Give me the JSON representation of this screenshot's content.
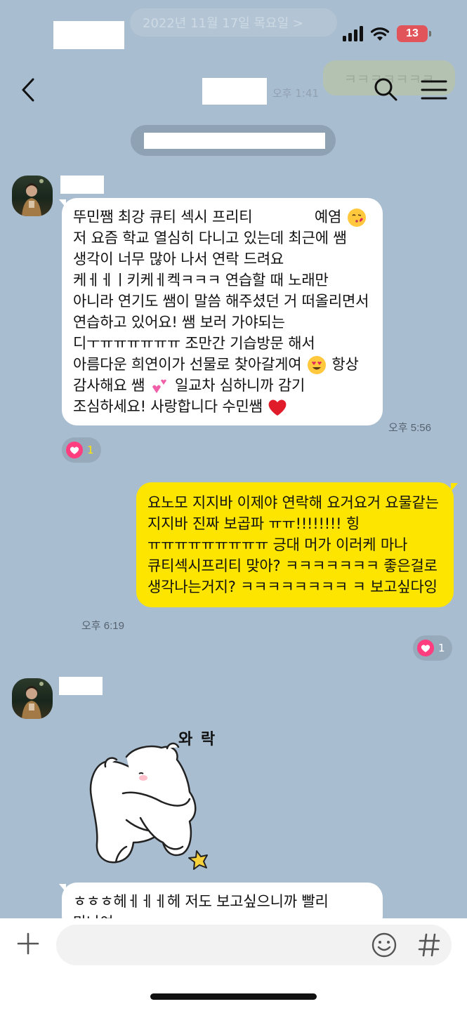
{
  "status_bar": {
    "battery": "13"
  },
  "ghost": {
    "date_banner": "2022년 11월 17일 목요일 >",
    "bubble": "ㅋㅋㅋㅋㅋㅋㅋ",
    "time": "오후 1:41"
  },
  "header": {
    "back_icon": "chevron-left-icon",
    "search_icon": "search-icon",
    "menu_icon": "hamburger-menu-icon"
  },
  "messages": [
    {
      "sender": "other",
      "text_parts": [
        "뚜민쨈 최강 큐티 섹시 프리티 ",
        "예염",
        " 저 요즘 학교 열심히 다니고 있는데 최근에 쌤 생각이 너무 많아 나서 연락 드려요 케ㅔㅔㅣ키케ㅔ켁ㅋㅋㅋ 연습할 때 노래만 아니라 연기도 쌤이 말씀 해주셨던 거 떠올리면서 연습하고 있어요! 쌤 보러 가야되는 디ㅜㅠㅠㅠㅠㅠㅠ 조만간 기습방문 해서 아름다운 희연이가 선물로 찾아갈게여",
        " 항상 감사해요 쌤",
        " 일교차 심하니까 감기 조심하세요! 사랑합니다 수민쌤"
      ],
      "time": "오후 5:56",
      "reaction_count": "1"
    },
    {
      "sender": "me",
      "text": "요노모 지지바 이제야 연락해 요거요거 요물같는 지지바 진짜 보곱파 ㅠㅠ!!!!!!!!  힝 ㅠㅠㅠㅠㅠㅠㅠㅠㅠ 긍대 머가 이러케 마나 큐티섹시프리티 맞아? ㅋㅋㅋㅋㅋㅋㅋ 좋은걸로 생각나는거지? ㅋㅋㅋㅋㅋㅋㅋㅋ ㅋ 보고싶다잉",
      "time": "오후 6:19",
      "reaction_count": "1"
    },
    {
      "sender": "other",
      "type": "sticker",
      "sticker_text": "와 락"
    },
    {
      "sender": "other",
      "text": "ㅎㅎㅎ헤ㅔㅔㅔ헤 저도 보고싶으니까 빨리 만나여"
    }
  ],
  "input_bar": {
    "placeholder": "",
    "plus_icon": "plus-icon",
    "emoji_icon": "emoji-icon",
    "hash_icon": "hash-icon"
  }
}
